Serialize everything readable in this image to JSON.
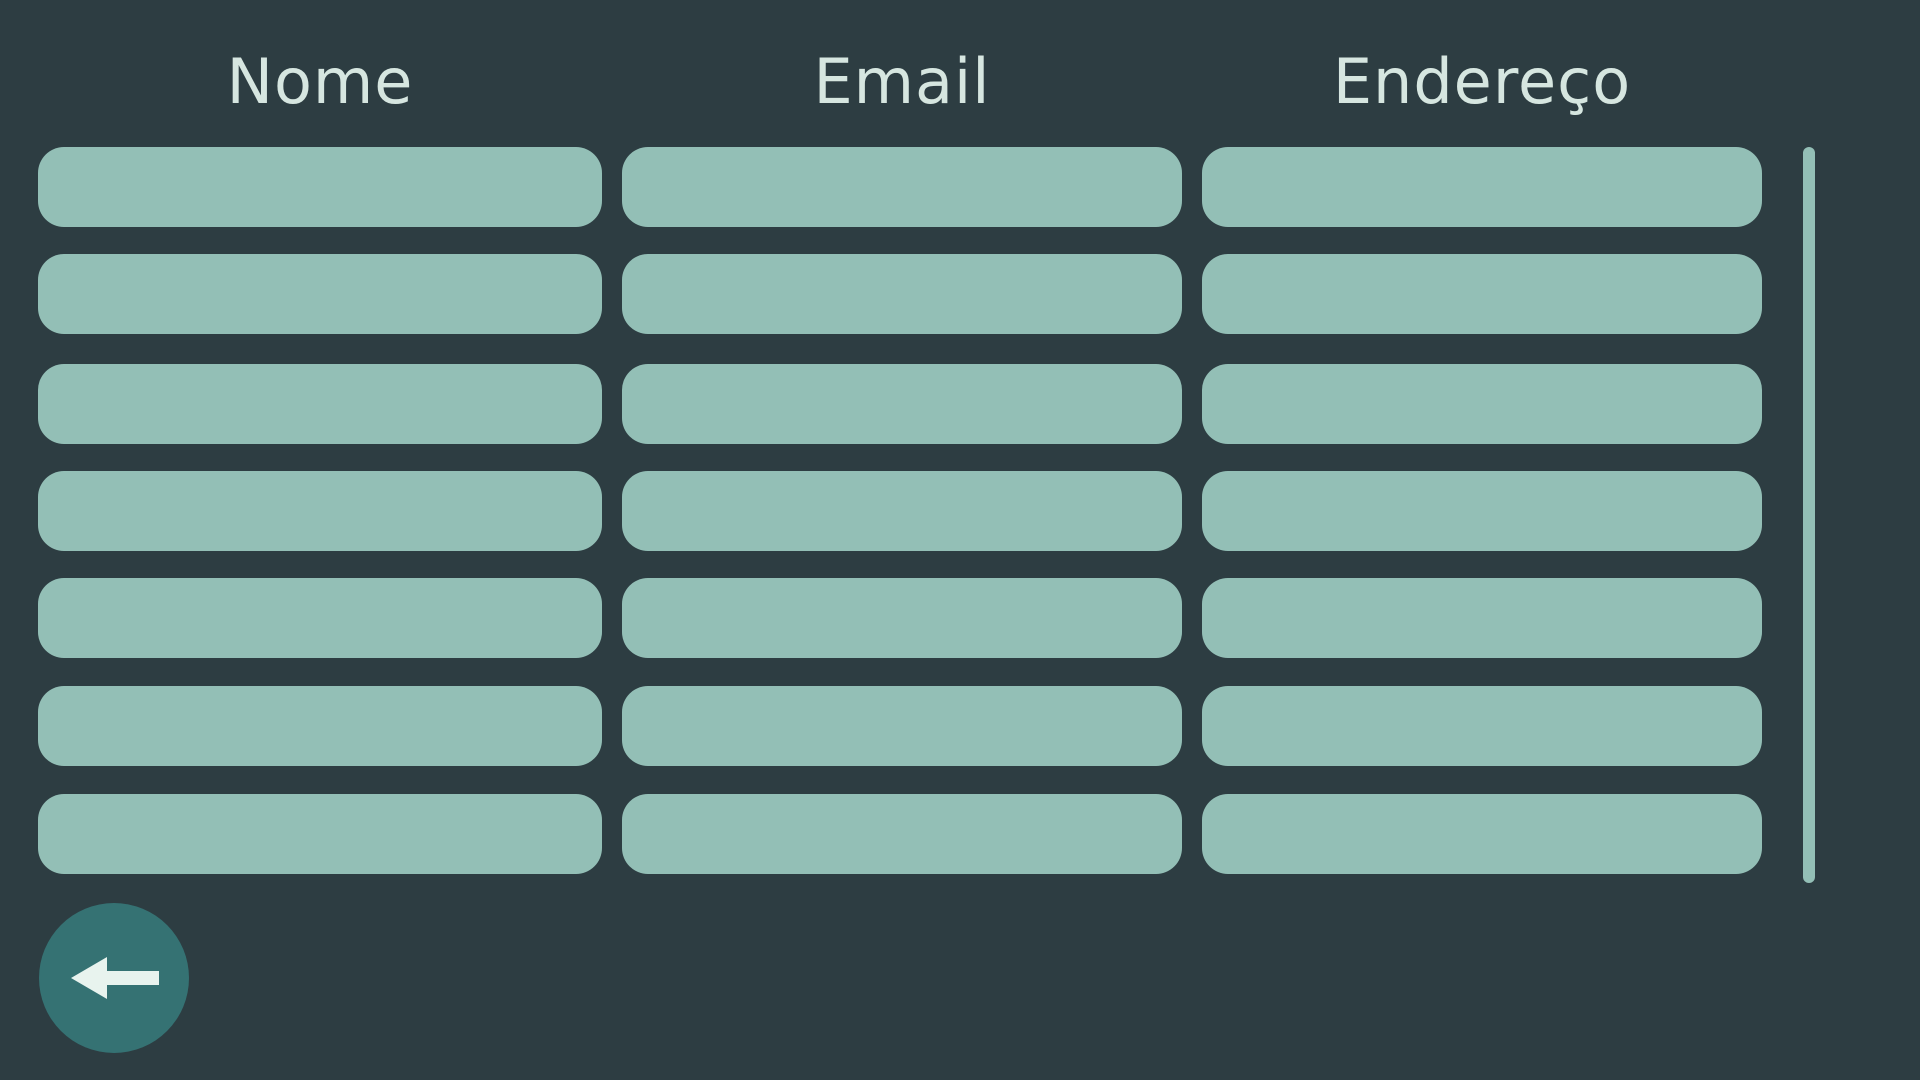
{
  "table": {
    "headers": [
      "Nome",
      "Email",
      "Endereço"
    ],
    "rows": [
      [
        "",
        "",
        ""
      ],
      [
        "",
        "",
        ""
      ],
      [
        "",
        "",
        ""
      ],
      [
        "",
        "",
        ""
      ],
      [
        "",
        "",
        ""
      ],
      [
        "",
        "",
        ""
      ],
      [
        "",
        "",
        ""
      ]
    ]
  },
  "back_button": {
    "icon": "arrow-left-icon"
  },
  "colors": {
    "background": "#2d3d42",
    "cell": "#93bfb6",
    "header_text": "#d6e6e0",
    "back_button": "#357273",
    "back_arrow": "#e8f3ee"
  }
}
